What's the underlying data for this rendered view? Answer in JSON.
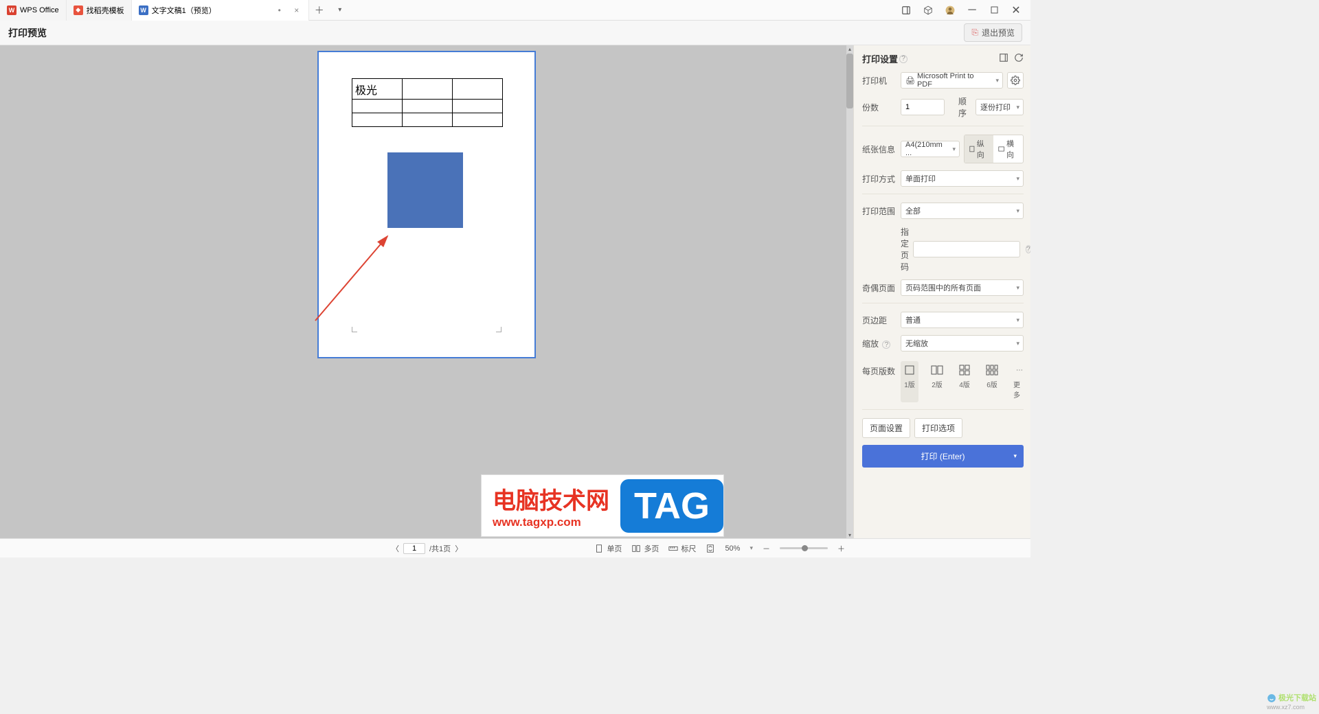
{
  "tabs": {
    "t1": {
      "label": "WPS Office"
    },
    "t2": {
      "label": "找稻壳模板"
    },
    "t3": {
      "label": "文字文稿1（预览）"
    }
  },
  "header": {
    "title": "打印预览",
    "exit": "退出预览"
  },
  "page_preview": {
    "table_cell": "极光"
  },
  "sidebar": {
    "title": "打印设置",
    "printer_label": "打印机",
    "printer_value": "Microsoft Print to PDF",
    "copies_label": "份数",
    "copies_value": "1",
    "order_label": "顺序",
    "order_value": "逐份打印",
    "paper_label": "纸张信息",
    "paper_value": "A4(210mm ...",
    "orient_portrait": "纵向",
    "orient_landscape": "横向",
    "method_label": "打印方式",
    "method_value": "单面打印",
    "range_label": "打印范围",
    "range_value": "全部",
    "specify_label": "指定页码",
    "parity_label": "奇偶页面",
    "parity_value": "页码范围中的所有页面",
    "margin_label": "页边距",
    "margin_value": "普通",
    "scale_label": "缩放",
    "scale_value": "无缩放",
    "perpage_label": "每页版数",
    "perpage_1": "1版",
    "perpage_2": "2版",
    "perpage_4": "4版",
    "perpage_6": "6版",
    "perpage_more": "更多",
    "page_setup": "页面设置",
    "print_options": "打印选项",
    "print_btn": "打印 (Enter)"
  },
  "statusbar": {
    "nav_prev": "〈",
    "page_current": "1",
    "page_total": "/共1页",
    "nav_next": "〉",
    "single": "单页",
    "multi": "多页",
    "ruler": "标尺",
    "zoom_value": "50%"
  },
  "watermark": {
    "line1": "电脑技术网",
    "line2": "www.tagxp.com",
    "tag": "TAG",
    "site": "极光下载站",
    "url": "www.xz7.com"
  }
}
